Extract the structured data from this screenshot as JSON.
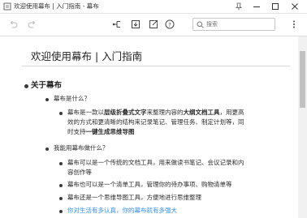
{
  "window": {
    "title": "欢迎使用幕布 | 入门指南 - 幕布"
  },
  "toolbar": {
    "search_placeholder": "搜索"
  },
  "document": {
    "title": "欢迎使用幕布 | 入门指南",
    "section": "关于幕布",
    "q1": "幕布是什么？",
    "a1_l1_pre": "幕布是一款以",
    "a1_l1_b1": "层级折叠式文字",
    "a1_l1_mid": "来整理内容的",
    "a1_l1_b2": "大纲文档工具",
    "a1_l1_post": "，用更高",
    "a1_l2": "效的方式和更清晰的结构来记录笔记、管理任务、制定计划等，同",
    "a1_l3_pre": "时支持",
    "a1_l3_b": "一键生成思维导图",
    "q2": "我能用幕布做什么？",
    "i1_l1": "幕布可以是一个传统的文档工具，用来做读书笔记、会议记录和内",
    "i1_l2": "容创作等",
    "i2": "幕布也可以是一个清单工具，管理你的待办事项、购物清单等",
    "i3": "幕布还是一个思维导图工具，方便地进行思维整理",
    "i4": "你对生活有多认真，你的幕布就有多强大",
    "link_color": "#3b8fe0"
  }
}
